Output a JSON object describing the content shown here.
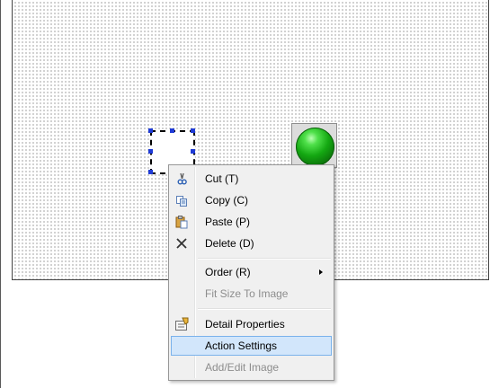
{
  "context_menu": {
    "items": [
      {
        "label": "Cut (T)",
        "icon": "scissors-icon",
        "enabled": true
      },
      {
        "label": "Copy (C)",
        "icon": "copy-icon",
        "enabled": true
      },
      {
        "label": "Paste (P)",
        "icon": "paste-icon",
        "enabled": true
      },
      {
        "label": "Delete (D)",
        "icon": "delete-x-icon",
        "enabled": true
      },
      {
        "label": "Order (R)",
        "icon": "",
        "enabled": true,
        "has_submenu": true
      },
      {
        "label": "Fit Size To Image",
        "icon": "",
        "enabled": false
      },
      {
        "label": "Detail Properties",
        "icon": "properties-icon",
        "enabled": true
      },
      {
        "label": "Action Settings",
        "icon": "",
        "enabled": true,
        "highlighted": true
      },
      {
        "label": "Add/Edit Image",
        "icon": "",
        "enabled": false
      }
    ]
  },
  "colors": {
    "selection_handle": "#1f3bd6",
    "lamp_green": "#14a812",
    "menu_highlight": "#d2e6fb",
    "menu_highlight_border": "#7ab2eb",
    "disabled_text": "#8d8d8d"
  }
}
